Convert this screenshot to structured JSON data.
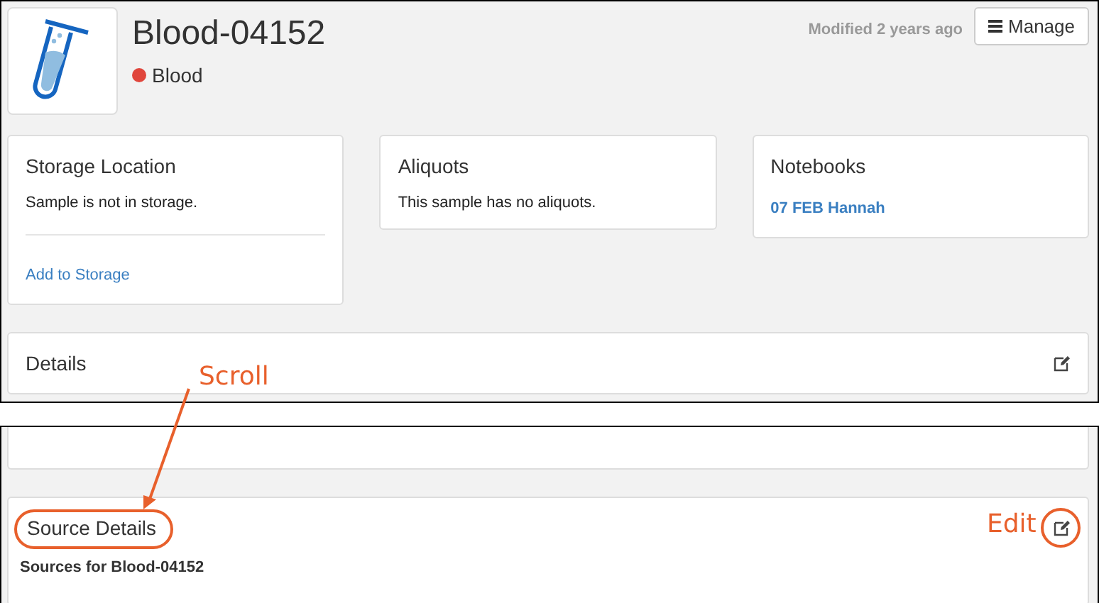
{
  "top_view": {
    "header": {
      "title": "Blood-04152",
      "sample_type": {
        "label": "Blood",
        "color": "#e0463c"
      },
      "modified": "Modified 2 years ago",
      "manage_button": "Manage"
    },
    "cards": [
      {
        "title": "Storage Location",
        "text": "Sample is not in storage.",
        "link": "Add to Storage"
      },
      {
        "title": "Aliquots",
        "text": "This sample has no aliquots."
      },
      {
        "title": "Notebooks",
        "link": "07 FEB Hannah"
      }
    ],
    "details_panel": {
      "title": "Details"
    }
  },
  "bottom_view": {
    "source_details": {
      "title": "Source Details",
      "subtitle": "Sources for Blood-04152"
    }
  },
  "annotations": {
    "scroll": "Scroll",
    "edit": "Edit"
  }
}
